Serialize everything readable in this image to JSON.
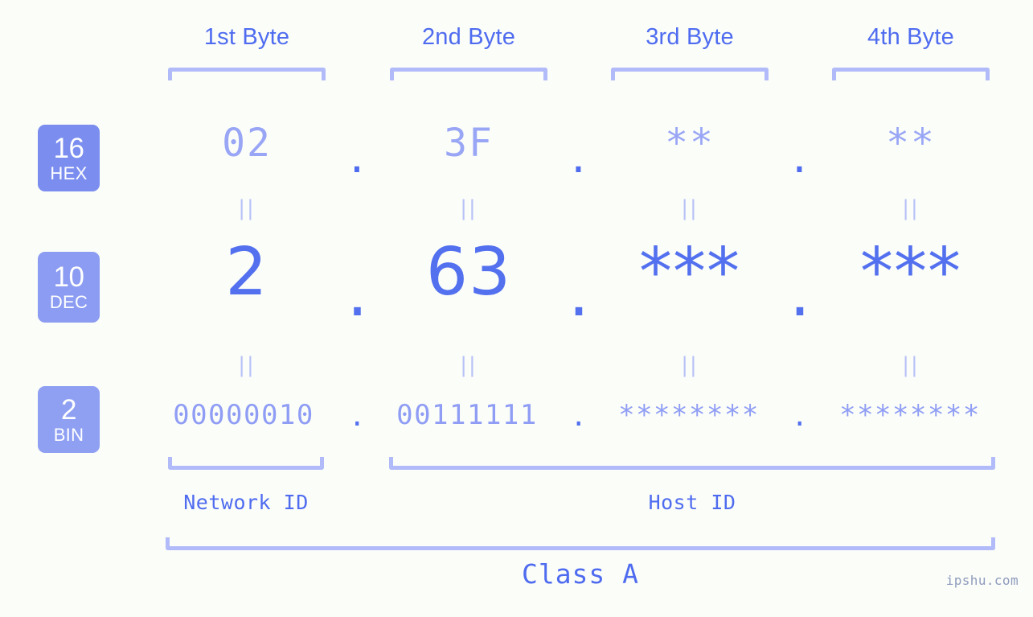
{
  "colors": {
    "background": "#fbfdf8",
    "primary_blue": "#4f6cf0",
    "light_blue": "#99a6f6",
    "bracket_blue": "#b2bbfa",
    "badge_hex": "#7b8ef0",
    "badge_dec": "#8b9cf2",
    "badge_bin": "#8fa0f3",
    "watermark": "#8e9bbd"
  },
  "byte_headers": [
    {
      "label": "1st Byte"
    },
    {
      "label": "2nd Byte"
    },
    {
      "label": "3rd Byte"
    },
    {
      "label": "4th Byte"
    }
  ],
  "bases": [
    {
      "number": "16",
      "abbr": "HEX"
    },
    {
      "number": "10",
      "abbr": "DEC"
    },
    {
      "number": "2",
      "abbr": "BIN"
    }
  ],
  "rows": {
    "hex": {
      "values": [
        "02",
        "3F",
        "**",
        "**"
      ],
      "separator": "."
    },
    "dec": {
      "values": [
        "2",
        "63",
        "***",
        "***"
      ],
      "separator": "."
    },
    "bin": {
      "values": [
        "00000010",
        "00111111",
        "********",
        "********"
      ],
      "separator": "."
    }
  },
  "equals_marks": {
    "glyph": "||",
    "meaning": "equals"
  },
  "segments": {
    "network_id": "Network ID",
    "host_id": "Host ID"
  },
  "class": {
    "label": "Class A"
  },
  "watermark": {
    "text": "ipshu.com"
  }
}
